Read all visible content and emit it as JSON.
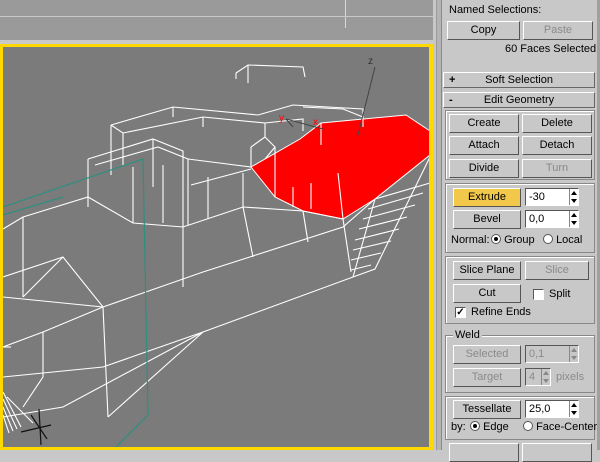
{
  "named_selections": {
    "label": "Named Selections:",
    "copy_label": "Copy",
    "paste_label": "Paste",
    "status": "60 Faces Selected"
  },
  "rollouts": {
    "soft_selection": {
      "sign": "+",
      "label": "Soft Selection"
    },
    "edit_geometry": {
      "sign": "-",
      "label": "Edit Geometry"
    }
  },
  "edit_geometry": {
    "create": "Create",
    "delete": "Delete",
    "attach": "Attach",
    "detach": "Detach",
    "divide": "Divide",
    "turn": "Turn",
    "extrude": "Extrude",
    "extrude_value": "-30",
    "bevel": "Bevel",
    "bevel_value": "0,0",
    "normal_label": "Normal:",
    "normal_group": "Group",
    "normal_local": "Local",
    "slice_plane": "Slice Plane",
    "slice": "Slice",
    "cut": "Cut",
    "split": "Split",
    "refine_ends": "Refine Ends",
    "refine_ends_checked": true,
    "split_checked": false
  },
  "weld": {
    "title": "Weld",
    "selected": "Selected",
    "selected_value": "0,1",
    "target": "Target",
    "target_value": "4",
    "target_unit": "pixels"
  },
  "tessellate": {
    "button": "Tessellate",
    "value": "25,0",
    "by_label": "by:",
    "edge": "Edge",
    "face_center": "Face-Center"
  },
  "viewport": {
    "axis_x": "x",
    "axis_y": "y",
    "axis_z": "z",
    "colors": {
      "background": "#7b7b7b",
      "active_border": "#ffd800",
      "wire": "#ffffff",
      "selection": "#ff0000",
      "gizmo": "#2f8f7f"
    }
  }
}
